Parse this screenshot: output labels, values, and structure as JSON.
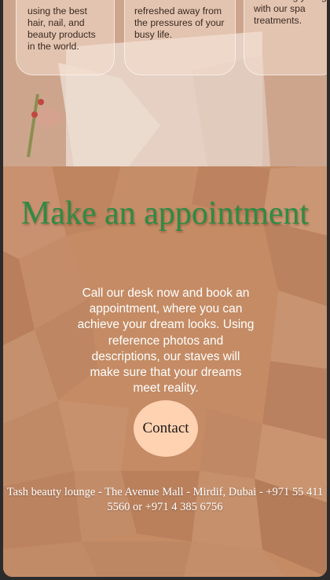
{
  "services": [
    {
      "text": "using the best hair, nail, and beauty products in the world."
    },
    {
      "text": "refreshed away from the pressures of your busy life."
    },
    {
      "text": "reality and come out feeling young with our spa treatments."
    }
  ],
  "appointment": {
    "heading": "Make an appointment",
    "body": "Call our desk now and book an appointment, where you can achieve your dream looks. Using reference photos and descriptions, our staves will make sure that your dreams meet reality.",
    "contact_label": "Contact"
  },
  "footer": {
    "text": "Tash beauty lounge - The Avenue Mall - Mirdif, Dubai - +971 55 411 5560 or +971 4 385 6756"
  },
  "colors": {
    "heading": "#2e8b45",
    "button_bg": "#ffd2b2",
    "background": "#c48a63"
  }
}
